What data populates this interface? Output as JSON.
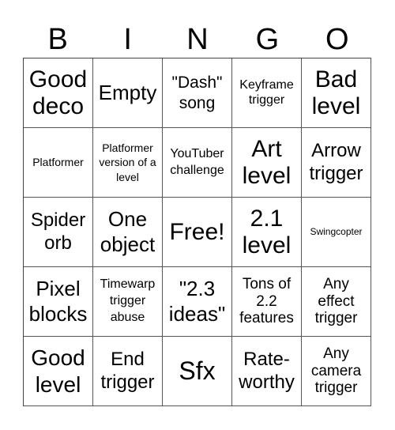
{
  "header": {
    "letters": [
      "B",
      "I",
      "N",
      "G",
      "O"
    ]
  },
  "cells": [
    "Good deco",
    "Empty",
    "\"Dash\" song",
    "Keyframe trigger",
    "Bad level",
    "Platformer",
    "Platformer version of a level",
    "YouTuber challenge",
    "Art level",
    "Arrow trigger",
    "Spider orb",
    "One object",
    "Free!",
    "2.1 level",
    "Swingcopter",
    "Pixel blocks",
    "Timewarp trigger abuse",
    "\"2.3 ideas\"",
    "Tons of 2.2 features",
    "Any effect trigger",
    "Good level",
    "End trigger",
    "Sfx",
    "Rate-worthy",
    "Any camera trigger"
  ]
}
